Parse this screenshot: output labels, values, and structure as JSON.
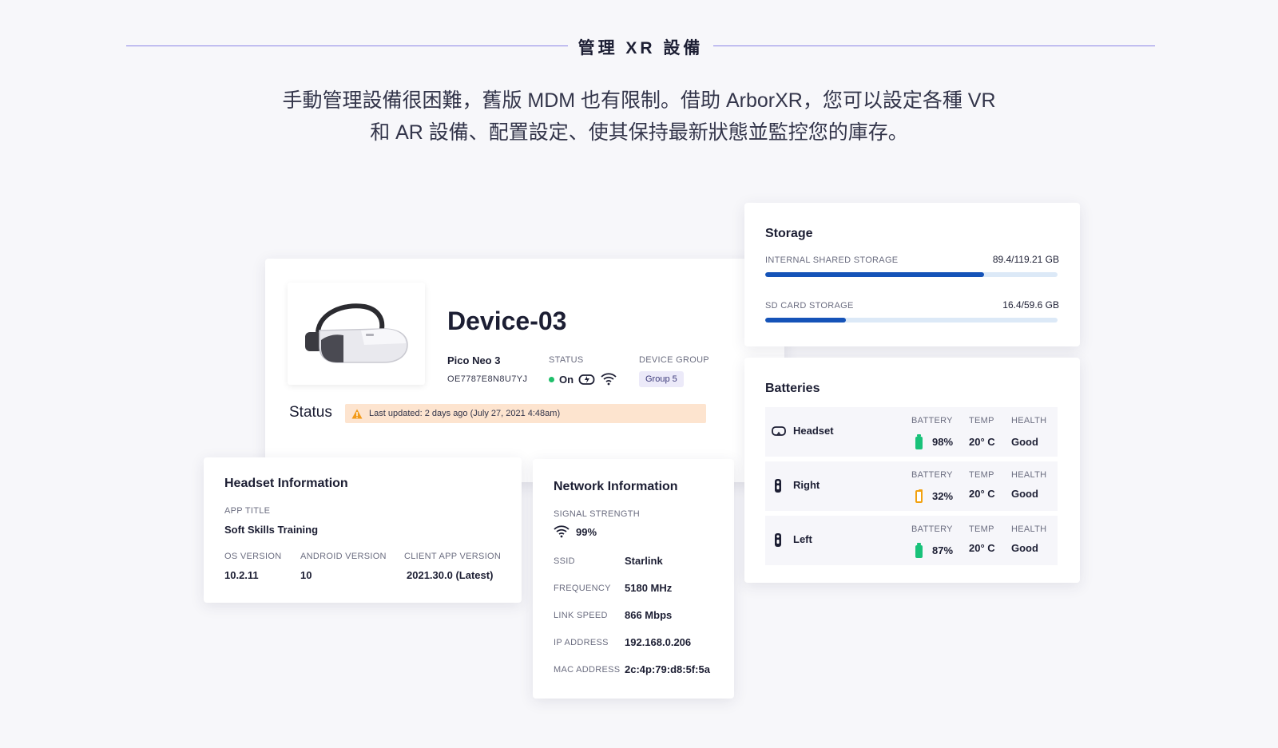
{
  "section_title": "管理 XR 設備",
  "intro": {
    "line1": "手動管理設備很困難，舊版 MDM 也有限制。借助 ArborXR，您可以設定各種 VR",
    "line2": "和 AR 設備、配置設定、使其保持最新狀態並監控您的庫存。"
  },
  "device": {
    "name": "Device-03",
    "model": "Pico Neo 3",
    "serial": "OE7787E8N8U7YJ",
    "status_label": "STATUS",
    "status_value": "On",
    "group_label": "DEVICE GROUP",
    "group_value": "Group 5",
    "status_heading": "Status",
    "last_updated": "Last updated: 2 days ago (July 27, 2021 4:48am)"
  },
  "headset_info": {
    "title": "Headset Information",
    "app_title_label": "APP TITLE",
    "app_title_value": "Soft Skills Training",
    "os_label": "OS VERSION",
    "os_value": "10.2.11",
    "android_label": "ANDROID VERSION",
    "android_value": "10",
    "client_label": "CLIENT APP VERSION",
    "client_value": "2021.30.0 (Latest)"
  },
  "network": {
    "title": "Network Information",
    "signal_label": "SIGNAL STRENGTH",
    "signal_value": "99%",
    "rows": [
      {
        "label": "SSID",
        "value": "Starlink"
      },
      {
        "label": "FREQUENCY",
        "value": "5180 MHz"
      },
      {
        "label": "LINK SPEED",
        "value": "866 Mbps"
      },
      {
        "label": "IP ADDRESS",
        "value": "192.168.0.206"
      },
      {
        "label": "MAC ADDRESS",
        "value": "2c:4p:79:d8:5f:5a"
      }
    ]
  },
  "storage": {
    "title": "Storage",
    "internal_label": "INTERNAL SHARED STORAGE",
    "internal_value": "89.4/119.21 GB",
    "internal_used": 89.4,
    "internal_total": 119.21,
    "sd_label": "SD CARD STORAGE",
    "sd_value": "16.4/59.6 GB",
    "sd_used": 16.4,
    "sd_total": 59.6,
    "bar_color": "#1553b8"
  },
  "batteries": {
    "title": "Batteries",
    "battery_label": "BATTERY",
    "temp_label": "TEMP",
    "health_label": "HEALTH",
    "items": [
      {
        "name": "Headset",
        "icon": "headset-icon",
        "battery": "98%",
        "temp": "20° C",
        "health": "Good",
        "level": "green"
      },
      {
        "name": "Right",
        "icon": "controller-icon",
        "battery": "32%",
        "temp": "20° C",
        "health": "Good",
        "level": "orange"
      },
      {
        "name": "Left",
        "icon": "controller-icon",
        "battery": "87%",
        "temp": "20° C",
        "health": "Good",
        "level": "green"
      }
    ]
  }
}
